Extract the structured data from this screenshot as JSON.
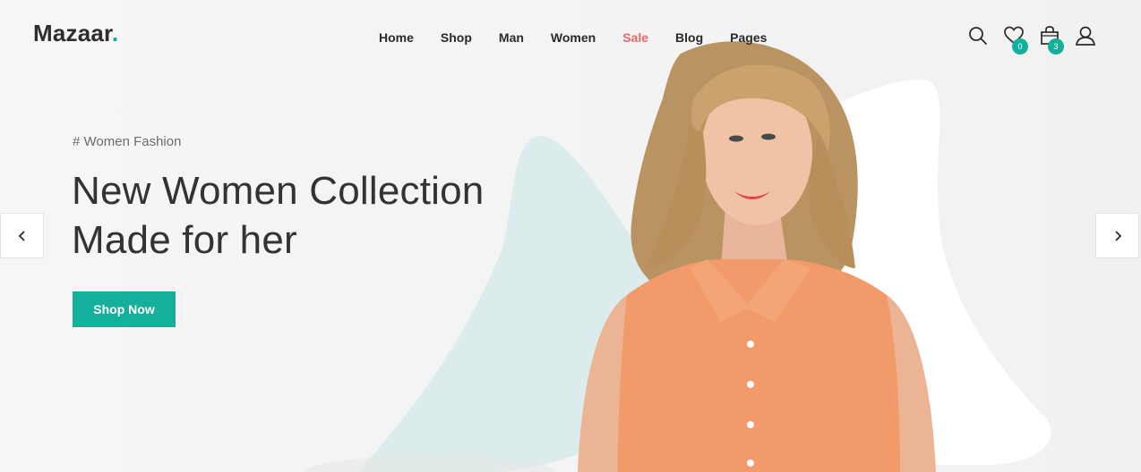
{
  "brand": {
    "name": "Mazaar",
    "dot": "."
  },
  "nav": {
    "items": [
      {
        "label": "Home"
      },
      {
        "label": "Shop"
      },
      {
        "label": "Man"
      },
      {
        "label": "Women"
      },
      {
        "label": "Sale"
      },
      {
        "label": "Blog"
      },
      {
        "label": "Pages"
      }
    ]
  },
  "header_icons": {
    "search": "search-icon",
    "wishlist": {
      "icon": "heart-icon",
      "count": "0"
    },
    "cart": {
      "icon": "shopping-bag-icon",
      "count": "3"
    },
    "account": "user-icon"
  },
  "hero": {
    "eyebrow": "# Women Fashion",
    "headline_line1": "New Women Collection",
    "headline_line2": "Made for her",
    "cta_label": "Shop Now"
  },
  "colors": {
    "accent": "#14b09b",
    "sale": "#ef6565",
    "text_dark": "#333333"
  }
}
